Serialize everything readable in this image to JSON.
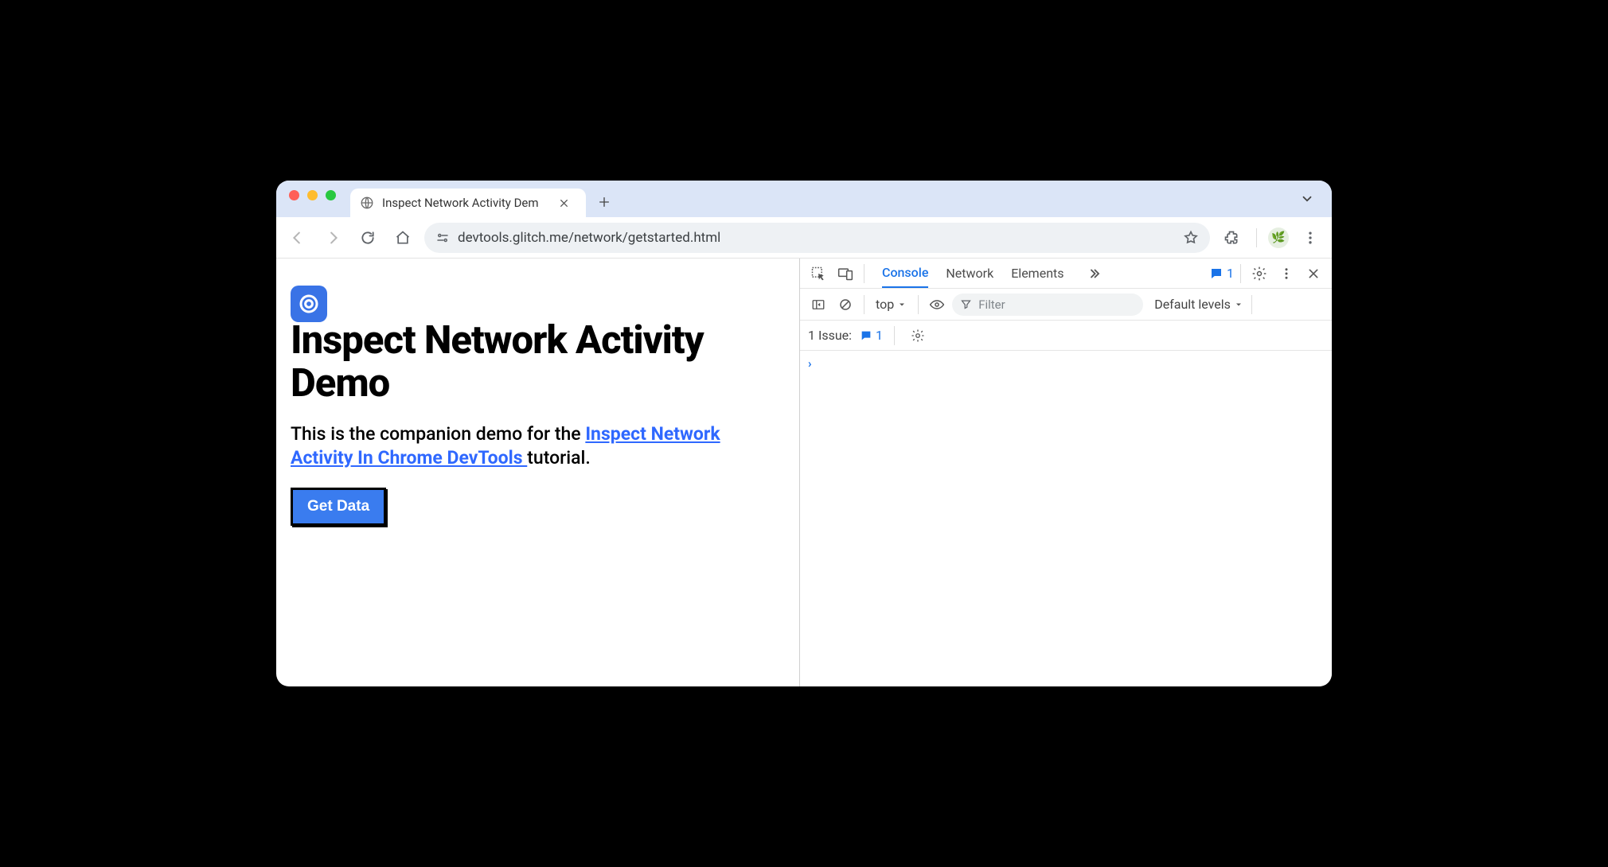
{
  "browser": {
    "tab_title": "Inspect Network Activity Dem",
    "url": "devtools.glitch.me/network/getstarted.html"
  },
  "page": {
    "heading": "Inspect Network Activity Demo",
    "intro_prefix": "This is the companion demo for the ",
    "link_text": "Inspect Network Activity In Chrome DevTools ",
    "intro_suffix": "tutorial.",
    "button_label": "Get Data"
  },
  "devtools": {
    "tabs": {
      "console": "Console",
      "network": "Network",
      "elements": "Elements"
    },
    "issue_count": "1",
    "context": "top",
    "filter_placeholder": "Filter",
    "levels_label": "Default levels",
    "issues_label": "1 Issue:",
    "issues_count2": "1"
  }
}
